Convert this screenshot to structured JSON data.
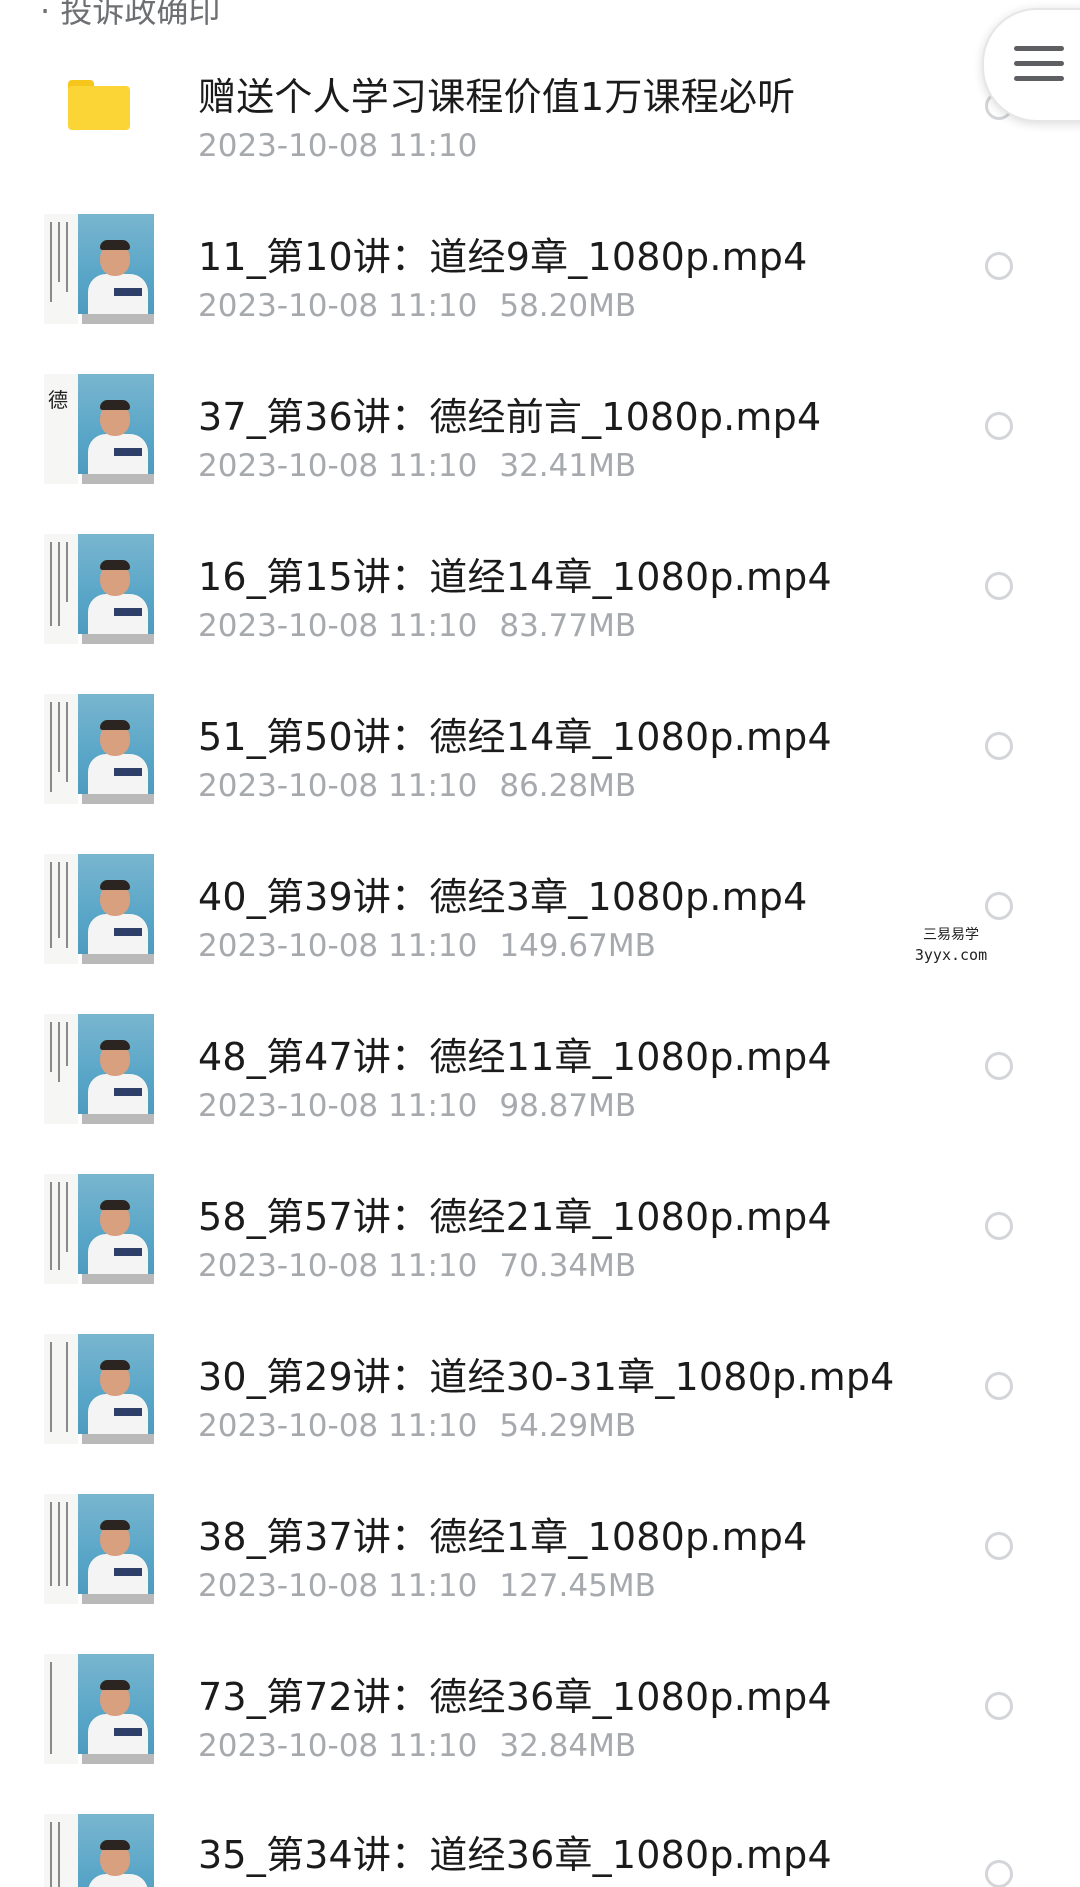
{
  "header": {
    "cropped_text": "· 投诉政确印"
  },
  "menu": {
    "icon": "hamburger-menu-icon"
  },
  "files": [
    {
      "type": "folder",
      "name": "赠送个人学习课程价值1万课程必听",
      "date": "2023-10-08  11:10",
      "size": ""
    },
    {
      "type": "video",
      "name": "11_第10讲：道经9章_1080p.mp4",
      "date": "2023-10-08  11:10",
      "size": "58.20MB"
    },
    {
      "type": "video",
      "name": "37_第36讲：德经前言_1080p.mp4",
      "date": "2023-10-08  11:10",
      "size": "32.41MB",
      "thumb_glyph": "德"
    },
    {
      "type": "video",
      "name": "16_第15讲：道经14章_1080p.mp4",
      "date": "2023-10-08  11:10",
      "size": "83.77MB"
    },
    {
      "type": "video",
      "name": "51_第50讲：德经14章_1080p.mp4",
      "date": "2023-10-08  11:10",
      "size": "86.28MB"
    },
    {
      "type": "video",
      "name": "40_第39讲：德经3章_1080p.mp4",
      "date": "2023-10-08  11:10",
      "size": "149.67MB"
    },
    {
      "type": "video",
      "name": "48_第47讲：德经11章_1080p.mp4",
      "date": "2023-10-08  11:10",
      "size": "98.87MB"
    },
    {
      "type": "video",
      "name": "58_第57讲：德经21章_1080p.mp4",
      "date": "2023-10-08  11:10",
      "size": "70.34MB"
    },
    {
      "type": "video",
      "name": "30_第29讲：道经30-31章_1080p.mp4",
      "date": "2023-10-08  11:10",
      "size": "54.29MB"
    },
    {
      "type": "video",
      "name": "38_第37讲：德经1章_1080p.mp4",
      "date": "2023-10-08  11:10",
      "size": "127.45MB"
    },
    {
      "type": "video",
      "name": "73_第72讲：德经36章_1080p.mp4",
      "date": "2023-10-08  11:10",
      "size": "32.84MB"
    },
    {
      "type": "video",
      "name": "35_第34讲：道经36章_1080p.mp4",
      "date": "",
      "size": ""
    }
  ],
  "watermark": {
    "line1": "三易易学",
    "line2": "3yyx.com"
  },
  "colors": {
    "title": "#1b1b1b",
    "meta": "#a6a9ad",
    "folder": "#fbd535",
    "radio_border": "#d3d5d8"
  }
}
